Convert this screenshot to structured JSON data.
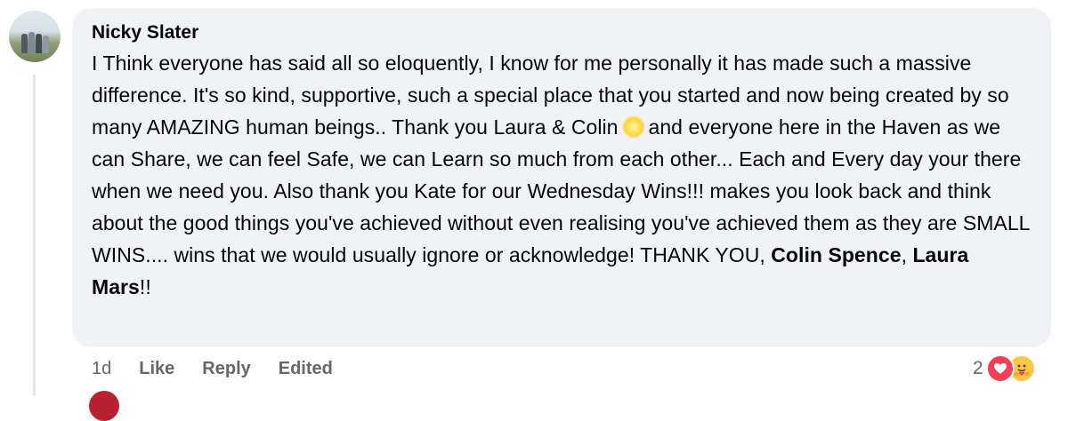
{
  "comment": {
    "author": "Nicky Slater",
    "text_segments": [
      "I Think everyone has said all so eloquently, I know for me personally it has made such a massive difference. It's so kind, supportive, such a special place that you started and now being created by so many AMAZING human beings.. Thank you Laura & Colin",
      "and everyone here in the Haven as we can Share, we can feel Safe, we can Learn so much from each other... Each and Every day your there when we need you. Also thank you Kate for our Wednesday Wins!!! makes you look back and think about the good things you've achieved without even realising you've achieved them as they are SMALL WINS.... wins that we would usually ignore or acknowledge! THANK YOU,",
      ", ",
      "!!"
    ],
    "emoji": "sparkle-emoji",
    "mentions": [
      "Colin Spence",
      "Laura Mars"
    ]
  },
  "actions": {
    "timestamp": "1d",
    "like": "Like",
    "reply": "Reply",
    "edited": "Edited"
  },
  "reactions": {
    "count": "2",
    "icons": [
      "heart-icon",
      "hug-icon"
    ],
    "colors": {
      "heart": "#f33e58",
      "hug": "#f7c845"
    }
  }
}
